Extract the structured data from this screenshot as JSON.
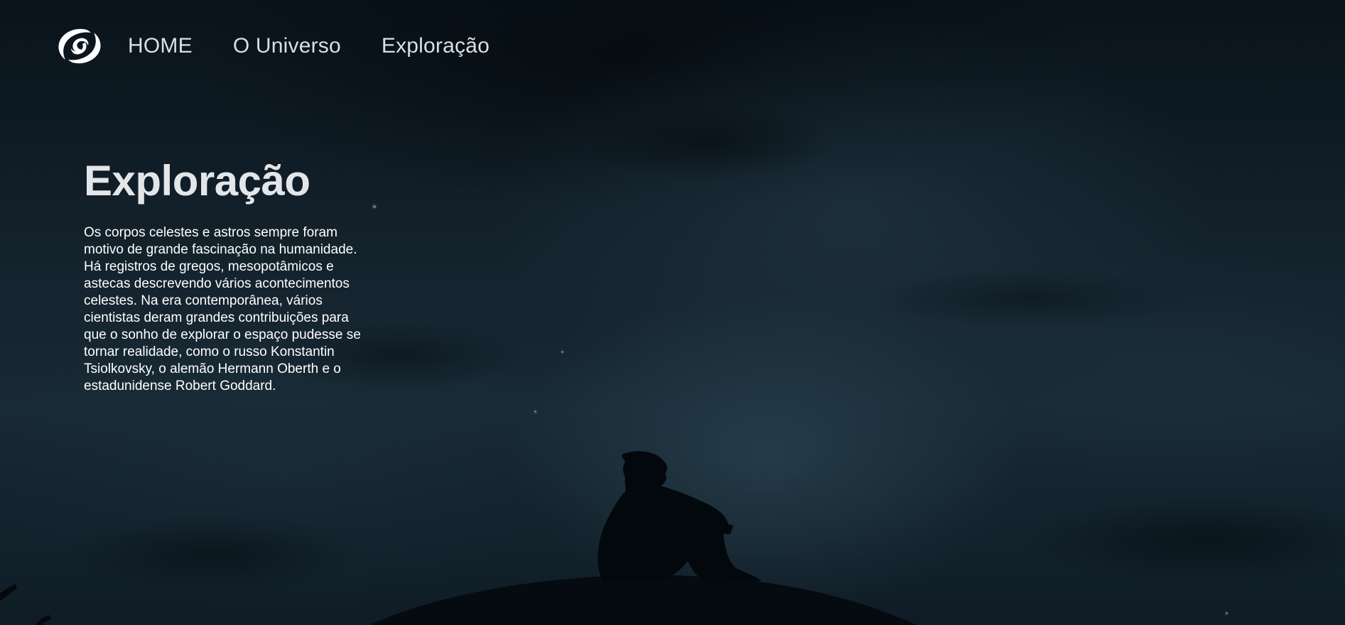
{
  "nav": {
    "logo_icon": "spiral-galaxy-logo-icon",
    "links": [
      {
        "label": "HOME"
      },
      {
        "label": "O Universo"
      },
      {
        "label": "Exploração"
      }
    ]
  },
  "main": {
    "title": "Exploração",
    "paragraph": "Os corpos celestes e astros sempre foram motivo de grande fascinação na humanidade. Há registros de gregos, mesopotâmicos e astecas descrevendo vários acontecimentos celestes. Na era contemporânea, vários cientistas deram grandes contribuições para que o sonho de explorar o espaço pudesse se tornar realidade, como o russo Konstantin Tsiolkovsky, o alemão Hermann Oberth e o estadunidense Robert Goddard."
  },
  "colors": {
    "background": "#0b141c",
    "nav_text": "#d9dfe4",
    "title_text": "#e3e6e9",
    "body_text": "#ffffff"
  }
}
